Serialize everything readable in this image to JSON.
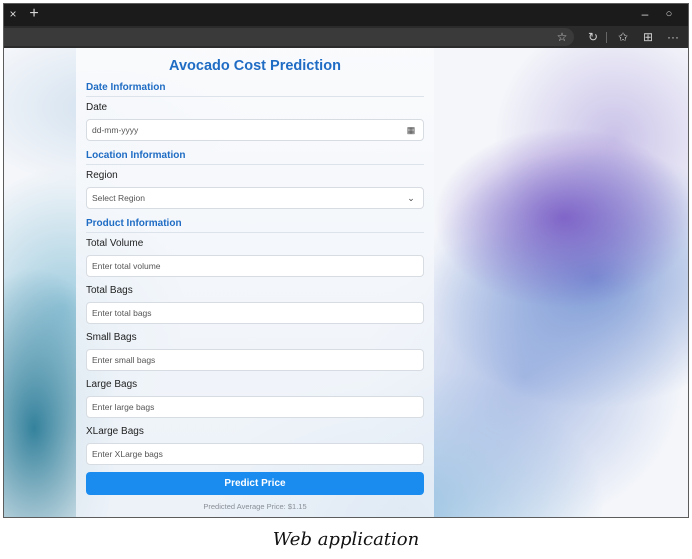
{
  "browser": {
    "titlebar": {
      "close_icon": "×",
      "new_tab_icon": "+",
      "minimize_icon": "–",
      "restore_icon": "○"
    },
    "toolbar": {
      "favorite_icon": "☆",
      "refresh_icon": "↻",
      "favorites_icon": "✩",
      "collections_icon": "⊞",
      "more_icon": "···"
    }
  },
  "app": {
    "title": "Avocado Cost Prediction",
    "sections": {
      "date": "Date Information",
      "location": "Location Information",
      "product": "Product Information"
    },
    "fields": {
      "date": {
        "label": "Date",
        "placeholder": "dd-mm-yyyy",
        "icon": "▦"
      },
      "region": {
        "label": "Region",
        "selected": "Select Region",
        "icon": "⌄"
      },
      "total_volume": {
        "label": "Total Volume",
        "placeholder": "Enter total volume"
      },
      "total_bags": {
        "label": "Total Bags",
        "placeholder": "Enter total bags"
      },
      "small_bags": {
        "label": "Small Bags",
        "placeholder": "Enter small bags"
      },
      "large_bags": {
        "label": "Large Bags",
        "placeholder": "Enter large bags"
      },
      "xlarge_bags": {
        "label": "XLarge Bags",
        "placeholder": "Enter XLarge bags"
      }
    },
    "predict_button": "Predict Price",
    "result": "Predicted Average Price: $1.15"
  },
  "caption": "Web application"
}
